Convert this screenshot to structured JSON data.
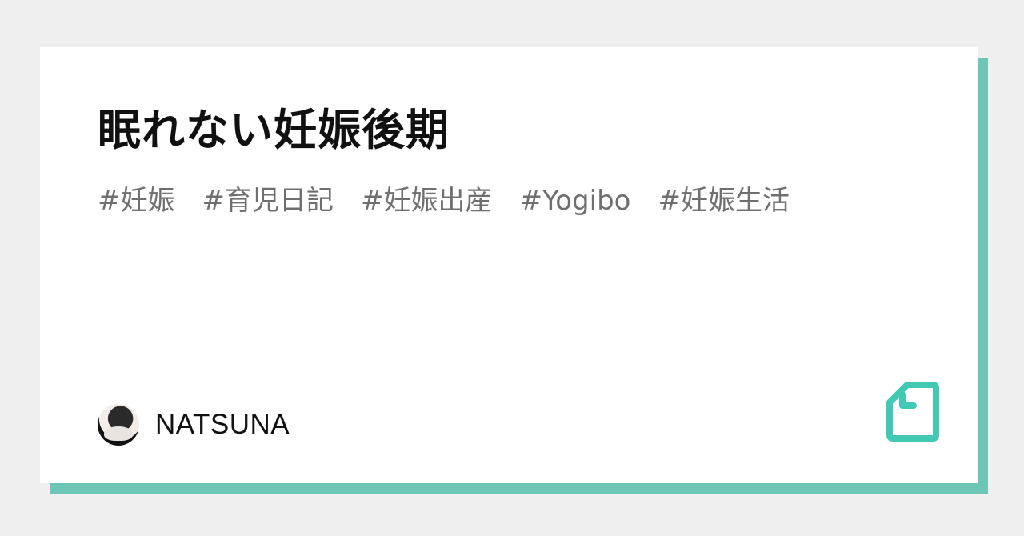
{
  "article": {
    "title": "眠れない妊娠後期",
    "tags": [
      "#妊娠",
      "#育児日記",
      "#妊娠出産",
      "#Yogibo",
      "#妊娠生活"
    ],
    "author_name": "NATSUNA"
  },
  "icons": {
    "avatar": "author-avatar",
    "logo": "note-document-icon"
  },
  "colors": {
    "background": "#efefef",
    "card": "#ffffff",
    "accent": "#6dc5b6",
    "logo": "#41c9b4",
    "title": "#111111",
    "tag": "#6f6f6f"
  }
}
